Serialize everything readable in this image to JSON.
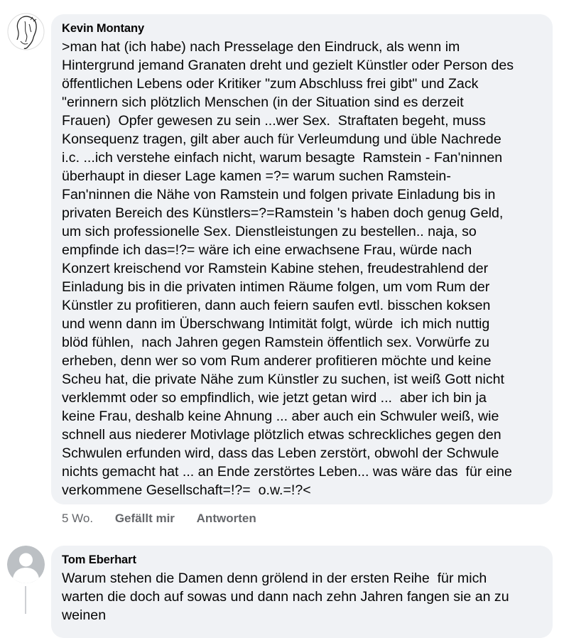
{
  "comments": [
    {
      "author": "Kevin Montany",
      "avatar_icon": "sketch-face-avatar-icon",
      "lines": [
        ">man hat (ich habe) nach Presselage den Eindruck, als wenn im",
        "Hintergrund jemand Granaten dreht und gezielt Künstler oder Person des",
        "öffentlichen Lebens oder Kritiker \"zum Abschluss frei gibt\" und Zack",
        "\"erinnern sich plötzlich Menschen (in der Situation sind es derzeit",
        "Frauen)  Opfer gewesen zu sein ...wer Sex.  Straftaten begeht, muss",
        "Konsequenz tragen, gilt aber auch für Verleumdung und üble Nachrede",
        "i.c. ...ich verstehe einfach nicht, warum besagte  Ramstein - Fan'ninnen",
        "überhaupt in dieser Lage kamen =?= warum suchen Ramstein-",
        "Fan'ninnen die Nähe von Ramstein und folgen private Einladung bis in",
        "privaten Bereich des Künstlers=?=Ramstein 's haben doch genug Geld,",
        "um sich professionelle Sex. Dienstleistungen zu bestellen.. naja, so",
        "empfinde ich das=!?= wäre ich eine erwachsene Frau, würde nach",
        "Konzert kreischend vor Ramstein Kabine stehen, freudestrahlend der",
        "Einladung bis in die privaten intimen Räume folgen, um vom Rum der",
        "Künstler zu profitieren, dann auch feiern saufen evtl. bisschen koksen",
        "und wenn dann im Überschwang Intimität folgt, würde  ich mich nuttig",
        "blöd fühlen,  nach Jahren gegen Ramstein öffentlich sex. Vorwürfe zu",
        "erheben, denn wer so vom Rum anderer profitieren möchte und keine",
        "Scheu hat, die private Nähe zum Künstler zu suchen, ist weiß Gott nicht",
        "verklemmt oder so empfindlich, wie jetzt getan wird ...  aber ich bin ja",
        "keine Frau, deshalb keine Ahnung ... aber auch ein Schwuler weiß, wie",
        "schnell aus niederer Motivlage plötzlich etwas schreckliches gegen den",
        "Schwulen erfunden wird, dass das Leben zerstört, obwohl der Schwule",
        "nichts gemacht hat ... an Ende zerstörtes Leben... was wäre das  für eine",
        "verkommene Gesellschaft=!?=  o.w.=!?<"
      ],
      "time": "5 Wo.",
      "like_label": "Gefällt mir",
      "reply_label": "Antworten"
    },
    {
      "author": "Tom Eberhart",
      "avatar_icon": "default-user-avatar-icon",
      "lines": [
        "Warum stehen die Damen denn grölend in der ersten Reihe  für mich",
        "warten die doch auf sowas und dann nach zehn Jahren fangen sie an zu",
        "weinen"
      ]
    }
  ],
  "colors": {
    "bubble_bg": "#f0f2f5",
    "text": "#050505",
    "secondary_text": "#65676b",
    "avatar_placeholder": "#bcc0c4"
  }
}
